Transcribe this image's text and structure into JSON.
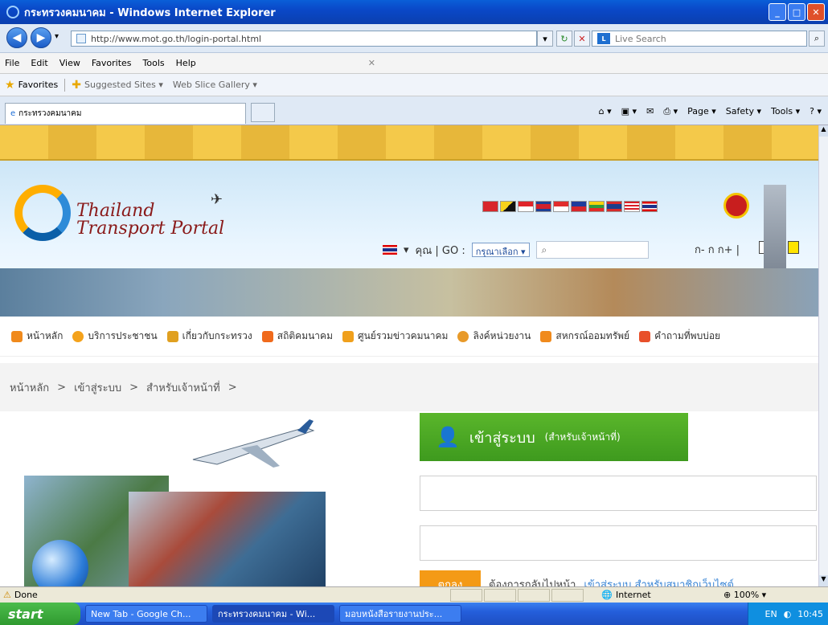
{
  "window": {
    "title": "กระทรวงคมนาคม - Windows Internet Explorer"
  },
  "address": {
    "url": "http://www.mot.go.th/login-portal.html",
    "search_placeholder": "Live Search"
  },
  "menu": [
    "File",
    "Edit",
    "View",
    "Favorites",
    "Tools",
    "Help"
  ],
  "favorites": {
    "label": "Favorites",
    "items": [
      "Suggested Sites ▾",
      "Web Slice Gallery ▾"
    ]
  },
  "tab": {
    "label": "กระทรวงคมนาคม"
  },
  "commandbar": [
    "Page ▾",
    "Safety ▾",
    "Tools ▾"
  ],
  "site": {
    "logo_line1": "Thailand",
    "logo_line2": "Transport Portal",
    "lang_label": "คุณ | GO :",
    "go_select": "กรุณาเลือก",
    "font_size": "ก- ก ก+ |",
    "nav": [
      "หน้าหลัก",
      "บริการประชาชน",
      "เกี่ยวกับกระทรวง",
      "สถิติคมนาคม",
      "ศูนย์รวมข่าวคมนาคม",
      "ลิงค์หน่วยงาน",
      "สหกรณ์ออมทรัพย์",
      "คำถามที่พบบ่อย"
    ],
    "breadcrumb": [
      "หน้าหลัก",
      ">",
      "เข้าสู่ระบบ",
      ">",
      "สำหรับเจ้าหน้าที่",
      ">"
    ],
    "login": {
      "title": "เข้าสู่ระบบ",
      "subtitle": "(สำหรับเจ้าหน้าที่)",
      "ok": "ตกลง",
      "return_text": "ต้องการกลับไปหน้า",
      "return_link": "เข้าสู่ระบบ สำหรับสมาชิกเว็บไซต์"
    }
  },
  "statusbar": {
    "left": "Done",
    "zone": "Internet",
    "zoom": "100%"
  },
  "taskbar": {
    "start": "start",
    "items": [
      "New Tab - Google Ch...",
      "กระทรวงคมนาคม - Wi...",
      "มอบหนังสือรายงานประ..."
    ],
    "lang": "EN",
    "time": "10:45"
  }
}
